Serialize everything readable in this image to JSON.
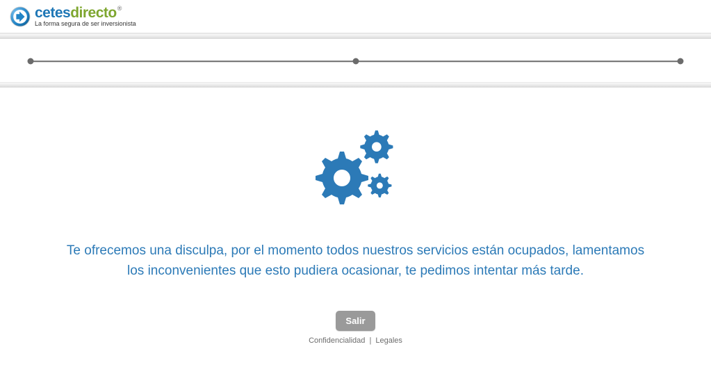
{
  "logo": {
    "part1": "cetes",
    "part2": "directo",
    "registered": "®",
    "tagline": "La forma segura de ser inversionista"
  },
  "message": "Te ofrecemos una disculpa, por el momento todos nuestros servicios están ocupados, lamentamos los inconvenientes que esto pudiera ocasionar, te pedimos intentar más tarde.",
  "exit_button": "Salir",
  "footer": {
    "confidentiality": "Confidencialidad",
    "separator": "|",
    "legal": "Legales"
  },
  "colors": {
    "accent_blue": "#2c7ab7",
    "logo_green": "#7ea62f",
    "btn_gray": "#9a9a9a"
  }
}
